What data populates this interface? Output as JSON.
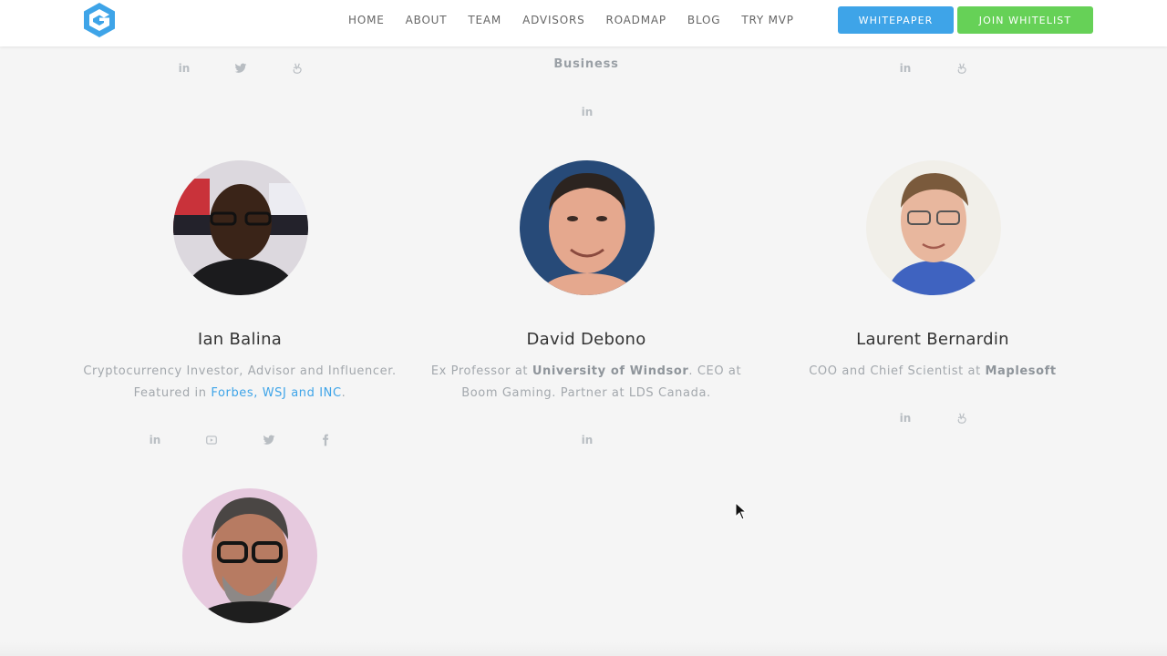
{
  "nav": {
    "items": [
      "HOME",
      "ABOUT",
      "TEAM",
      "ADVISORS",
      "ROADMAP",
      "BLOG",
      "TRY MVP"
    ],
    "whitepaper": "WHITEPAPER",
    "join": "JOIN WHITELIST"
  },
  "colors": {
    "accent_blue": "#3ea4e8",
    "accent_green": "#66d157",
    "background": "#f5f5f5"
  },
  "top_row": {
    "middle_desc": "Business"
  },
  "icons": {
    "linkedin": "in",
    "youtube": "You\nTube"
  },
  "advisors": [
    {
      "name": "Ian Balina",
      "desc_line1": "Cryptocurrency Investor, Advisor and Influencer.",
      "desc_prefix": "Featured in ",
      "desc_link": "Forbes, WSJ and INC",
      "desc_suffix": "."
    },
    {
      "name": "David Debono",
      "desc_pre": "Ex Professor at ",
      "desc_bold": "University of Windsor",
      "desc_mid": ". CEO at",
      "desc_line2": "Boom Gaming. Partner at LDS Canada."
    },
    {
      "name": "Laurent Bernardin",
      "desc_pre": "COO and Chief Scientist at ",
      "desc_bold": "Maplesoft"
    }
  ]
}
